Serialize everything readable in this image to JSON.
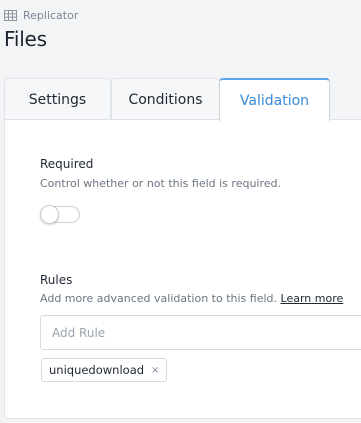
{
  "breadcrumb": {
    "icon": "table-grid-icon",
    "label": "Replicator"
  },
  "page": {
    "title": "Files"
  },
  "tabs": [
    {
      "label": "Settings",
      "active": false
    },
    {
      "label": "Conditions",
      "active": false
    },
    {
      "label": "Validation",
      "active": true
    }
  ],
  "required": {
    "label": "Required",
    "help": "Control whether or not this field is required.",
    "enabled": false
  },
  "rules": {
    "label": "Rules",
    "help": "Add more advanced validation to this field.",
    "learn_more": "Learn more",
    "input_placeholder": "Add Rule",
    "input_value": "",
    "tags": [
      {
        "label": "uniquedownload",
        "remove_icon": "×"
      }
    ]
  },
  "colors": {
    "accent": "#3a8ad6",
    "accent_border": "#5aa6e8"
  }
}
